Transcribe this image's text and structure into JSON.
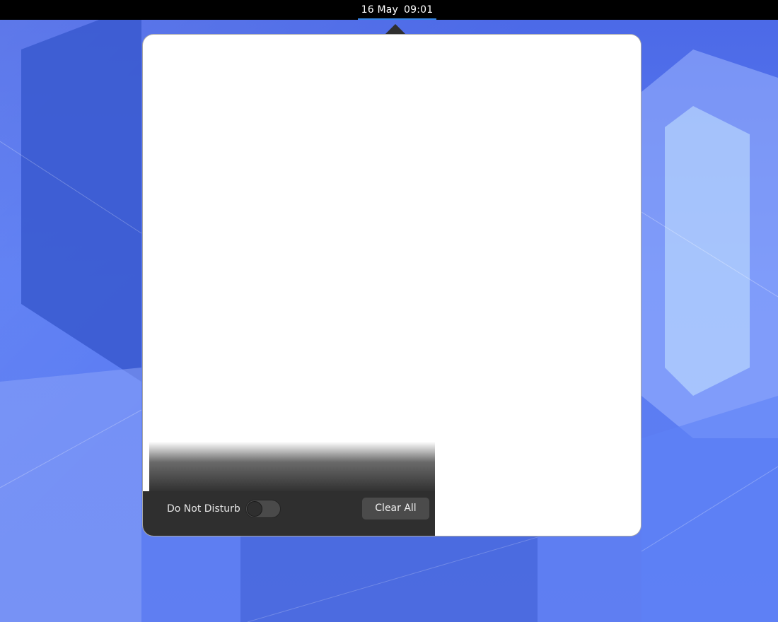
{
  "topbar": {
    "date": "16 May",
    "time": "09:01",
    "accent_color": "#3584e4"
  },
  "message_tray": {
    "footer": {
      "dnd_label": "Do Not Disturb",
      "dnd_enabled": false,
      "clear_all_label": "Clear All"
    }
  },
  "colors": {
    "panel_bg": "#000000",
    "popover_footer_bg": "#2f2f2f",
    "wallpaper_base": "#5a7cf3"
  }
}
